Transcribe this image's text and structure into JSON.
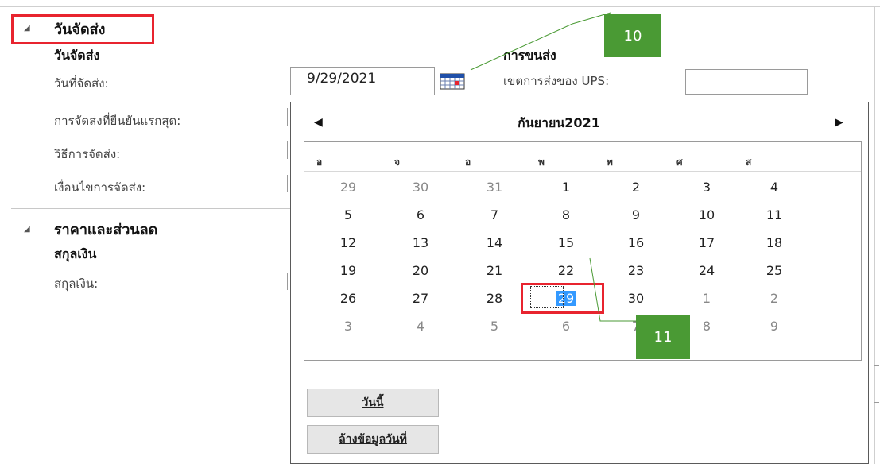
{
  "delivery_section": {
    "title": "วันจัดส่ง",
    "subtitle": "วันจัดส่ง",
    "fields": [
      {
        "label": "วันที่จัดส่ง:"
      },
      {
        "label": "การจัดส่งที่ยืนยันแรกสุด:"
      },
      {
        "label": "วิธีการจัดส่ง:"
      },
      {
        "label": "เงื่อนไขการจัดส่ง:"
      }
    ],
    "date_value": "9/29/2021"
  },
  "shipping": {
    "title": "การขนส่ง",
    "ups_label": "เขตการส่งของ UPS:",
    "ups_value": ""
  },
  "pricing_section": {
    "title": "ราคาและส่วนลด",
    "subtitle": "สกุลเงิน",
    "currency_label": "สกุลเงิน:"
  },
  "calendar": {
    "month_title": "กันยายน2021",
    "prev_icon": "triangle-left-icon",
    "next_icon": "triangle-right-icon",
    "weekdays": [
      "อ",
      "จ",
      "อ",
      "พ",
      "พ",
      "ศ",
      "ส"
    ],
    "weeks": [
      [
        "29",
        "30",
        "31",
        "1",
        "2",
        "3",
        "4"
      ],
      [
        "5",
        "6",
        "7",
        "8",
        "9",
        "10",
        "11"
      ],
      [
        "12",
        "13",
        "14",
        "15",
        "16",
        "17",
        "18"
      ],
      [
        "19",
        "20",
        "21",
        "22",
        "23",
        "24",
        "25"
      ],
      [
        "26",
        "27",
        "28",
        "29",
        "30",
        "1",
        "2"
      ],
      [
        "3",
        "4",
        "5",
        "6",
        "7",
        "8",
        "9"
      ]
    ],
    "other_month_cells": [
      [
        0,
        0
      ],
      [
        0,
        1
      ],
      [
        0,
        2
      ],
      [
        4,
        5
      ],
      [
        4,
        6
      ],
      [
        5,
        0
      ],
      [
        5,
        1
      ],
      [
        5,
        2
      ],
      [
        5,
        3
      ],
      [
        5,
        4
      ],
      [
        5,
        5
      ],
      [
        5,
        6
      ]
    ],
    "selected_cell": [
      4,
      3
    ],
    "today_button": "วันนี้",
    "clear_button": "ล้างข้อมูลวันที่"
  },
  "callouts": [
    "10",
    "11"
  ],
  "colors": {
    "accent_red": "#e8242f",
    "callout_green": "#4a9a34",
    "selection_blue": "#3399ff"
  }
}
